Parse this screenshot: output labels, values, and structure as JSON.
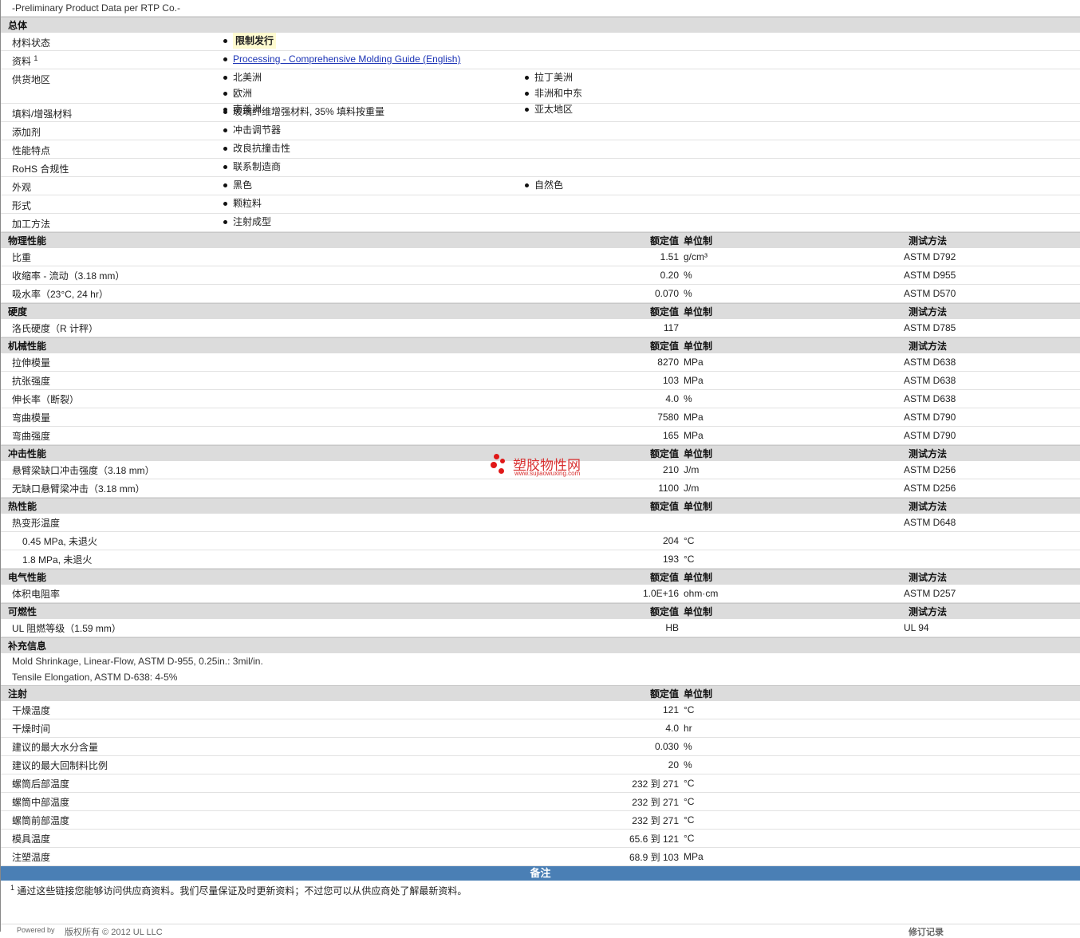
{
  "top_title": "-Preliminary Product Data per RTP Co.-",
  "general": {
    "title": "总体",
    "rows": [
      {
        "label": "材料状态",
        "items": [
          "限制发行"
        ]
      },
      {
        "label": "资料",
        "sup": "1",
        "items": [
          "Processing - Comprehensive Molding Guide (English)"
        ]
      },
      {
        "label": "供货地区",
        "items": [
          "北美洲",
          "拉丁美洲",
          "欧洲",
          "非洲和中东",
          "南美洲",
          "亚太地区"
        ]
      },
      {
        "label": "填料/增强材料",
        "items": [
          "玻璃纤维增强材料, 35% 填料按重量"
        ]
      },
      {
        "label": "添加剂",
        "items": [
          "冲击调节器"
        ]
      },
      {
        "label": "性能特点",
        "items": [
          "改良抗撞击性"
        ]
      },
      {
        "label": "RoHS 合规性",
        "items": [
          "联系制造商"
        ]
      },
      {
        "label": "外观",
        "items": [
          "黑色",
          "自然色"
        ]
      },
      {
        "label": "形式",
        "items": [
          "颗粒料"
        ]
      },
      {
        "label": "加工方法",
        "items": [
          "注射成型"
        ]
      }
    ]
  },
  "col_headers": {
    "nominal": "额定值",
    "unit": "单位制",
    "test": "测试方法"
  },
  "physical": {
    "title": "物理性能",
    "rows": [
      {
        "label": "比重",
        "value": "1.51",
        "unit": "g/cm³",
        "test": "ASTM D792"
      },
      {
        "label": "收缩率 - 流动（3.18 mm）",
        "value": "0.20",
        "unit": "%",
        "test": "ASTM D955"
      },
      {
        "label": "吸水率（23°C, 24 hr）",
        "value": "0.070",
        "unit": "%",
        "test": "ASTM D570"
      }
    ]
  },
  "hardness": {
    "title": "硬度",
    "rows": [
      {
        "label": "洛氏硬度（R 计秤）",
        "value": "117",
        "unit": "",
        "test": "ASTM D785"
      }
    ]
  },
  "mechanical": {
    "title": "机械性能",
    "rows": [
      {
        "label": "拉伸模量",
        "value": "8270",
        "unit": "MPa",
        "test": "ASTM D638"
      },
      {
        "label": "抗张强度",
        "value": "103",
        "unit": "MPa",
        "test": "ASTM D638"
      },
      {
        "label": "伸长率（断裂）",
        "value": "4.0",
        "unit": "%",
        "test": "ASTM D638"
      },
      {
        "label": "弯曲模量",
        "value": "7580",
        "unit": "MPa",
        "test": "ASTM D790"
      },
      {
        "label": "弯曲强度",
        "value": "165",
        "unit": "MPa",
        "test": "ASTM D790"
      }
    ]
  },
  "impact": {
    "title": "冲击性能",
    "rows": [
      {
        "label": "悬臂梁缺口冲击强度（3.18 mm）",
        "value": "210",
        "unit": "J/m",
        "test": "ASTM D256"
      },
      {
        "label": "无缺口悬臂梁冲击（3.18 mm）",
        "value": "1100",
        "unit": "J/m",
        "test": "ASTM D256"
      }
    ]
  },
  "thermal": {
    "title": "热性能",
    "rows": [
      {
        "label": "热变形温度",
        "value": "",
        "unit": "",
        "test": "ASTM D648"
      },
      {
        "label": "0.45 MPa, 未退火",
        "value": "204",
        "unit": "°C",
        "test": ""
      },
      {
        "label": "1.8 MPa, 未退火",
        "value": "193",
        "unit": "°C",
        "test": ""
      }
    ]
  },
  "electrical": {
    "title": "电气性能",
    "rows": [
      {
        "label": "体积电阻率",
        "value": "1.0E+16",
        "unit": "ohm·cm",
        "test": "ASTM D257"
      }
    ]
  },
  "flammability": {
    "title": "可燃性",
    "rows": [
      {
        "label": "UL 阻燃等级（1.59 mm）",
        "value": "HB",
        "unit": "",
        "test": "UL 94"
      }
    ]
  },
  "supplemental": {
    "title": "补充信息",
    "lines": [
      "Mold Shrinkage, Linear-Flow, ASTM D-955, 0.25in.: 3mil/in.",
      "Tensile Elongation, ASTM D-638: 4-5%"
    ]
  },
  "injection": {
    "title": "注射",
    "rows": [
      {
        "label": "干燥温度",
        "value": "121",
        "unit": "°C"
      },
      {
        "label": "干燥时间",
        "value": "4.0",
        "unit": "hr"
      },
      {
        "label": "建议的最大水分含量",
        "value": "0.030",
        "unit": "%"
      },
      {
        "label": "建议的最大回制料比例",
        "value": "20",
        "unit": "%"
      },
      {
        "label": "螺筒后部温度",
        "value": "232 到  271",
        "unit": "°C"
      },
      {
        "label": "螺筒中部温度",
        "value": "232 到  271",
        "unit": "°C"
      },
      {
        "label": "螺筒前部温度",
        "value": "232 到  271",
        "unit": "°C"
      },
      {
        "label": "模具温度",
        "value": "65.6 到  121",
        "unit": "°C"
      },
      {
        "label": "注塑温度",
        "value": "68.9 到  103",
        "unit": "MPa"
      }
    ]
  },
  "notes": {
    "title": "备注",
    "sup": "1",
    "text": "通过这些链接您能够访问供应商资料。我们尽量保证及时更新资料；不过您可以从供应商处了解最新资料。"
  },
  "watermark": {
    "cn": "塑胶物性网",
    "url": "www.sujiaowuxing.com"
  },
  "footer": {
    "powered": "Powered by",
    "copyright": "版权所有 © 2012 UL LLC",
    "revision": "修订记录"
  }
}
